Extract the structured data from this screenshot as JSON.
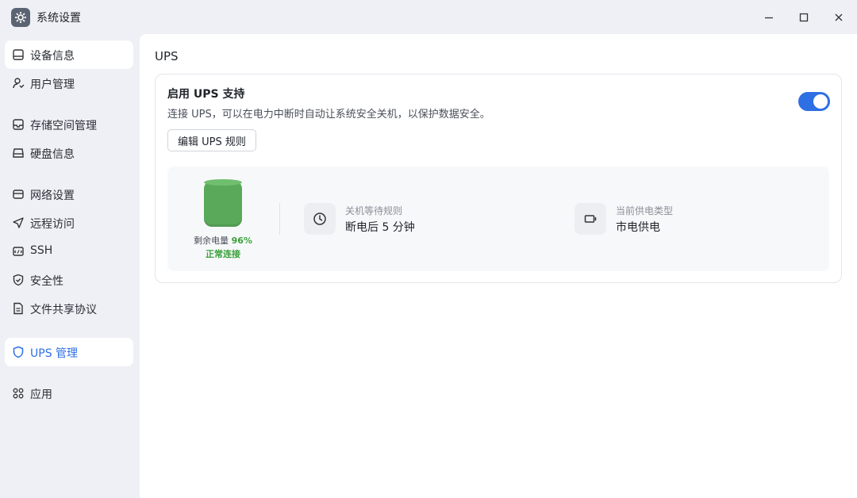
{
  "window": {
    "title": "系统设置",
    "controls": [
      "minimize",
      "maximize",
      "close"
    ]
  },
  "sidebar": {
    "items": [
      {
        "label": "设备信息",
        "icon": "device-icon"
      },
      {
        "label": "用户管理",
        "icon": "user-icon"
      },
      {
        "label": "存储空间管理",
        "icon": "storage-icon"
      },
      {
        "label": "硬盘信息",
        "icon": "disk-icon"
      },
      {
        "label": "网络设置",
        "icon": "network-icon"
      },
      {
        "label": "远程访问",
        "icon": "send-icon"
      },
      {
        "label": "SSH",
        "icon": "ssh-icon"
      },
      {
        "label": "安全性",
        "icon": "shield-check-icon"
      },
      {
        "label": "文件共享协议",
        "icon": "file-icon"
      },
      {
        "label": "UPS 管理",
        "icon": "shield-icon"
      },
      {
        "label": "应用",
        "icon": "apps-icon"
      }
    ],
    "selected": "UPS 管理"
  },
  "main": {
    "section_title": "UPS",
    "card": {
      "title": "启用 UPS 支持",
      "description": "连接 UPS，可以在电力中断时自动让系统安全关机，以保护数据安全。",
      "toggle_enabled": true,
      "edit_button": "编辑 UPS 规则"
    },
    "status": {
      "battery_label": "剩余电量",
      "battery_percent": "96%",
      "connection": "正常连接",
      "shutdown_rule_label": "关机等待规则",
      "shutdown_rule_value": "断电后 5 分钟",
      "power_type_label": "当前供电类型",
      "power_type_value": "市电供电"
    }
  },
  "colors": {
    "accent": "#2f6fe4",
    "battery_green": "#5aa95a",
    "status_green": "#3aa13a"
  }
}
